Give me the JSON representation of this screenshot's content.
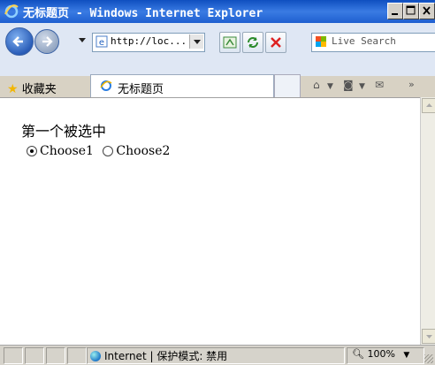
{
  "window": {
    "title": "无标题页 - Windows Internet Explorer"
  },
  "toolbar": {
    "address": "http://loc...",
    "search_placeholder": "Live Search"
  },
  "favorites": {
    "label": "收藏夹"
  },
  "tab": {
    "title": "无标题页"
  },
  "page": {
    "heading": "第一个被选中",
    "radios": [
      {
        "label": "Choose1",
        "checked": true
      },
      {
        "label": "Choose2",
        "checked": false
      }
    ]
  },
  "status": {
    "zone": "Internet | 保护模式: 禁用",
    "zoom": "100%"
  },
  "colors": {
    "title_bar": "#1e5fd0",
    "toolbar_bg": "#dfe7f4"
  }
}
